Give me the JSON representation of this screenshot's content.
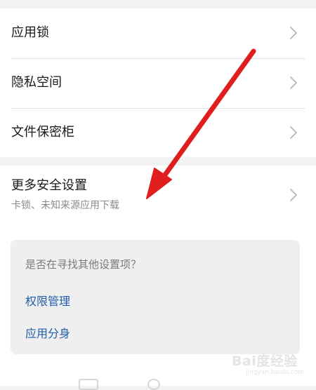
{
  "settings_group_1": {
    "items": [
      {
        "label": "应用锁"
      },
      {
        "label": "隐私空间"
      },
      {
        "label": "文件保密柜"
      }
    ]
  },
  "more_security": {
    "label": "更多安全设置",
    "sublabel": "卡锁、未知来源应用下载"
  },
  "suggestions": {
    "title": "是否在寻找其他设置项？",
    "links": [
      {
        "label": "权限管理"
      },
      {
        "label": "应用分身"
      }
    ]
  },
  "watermark": {
    "text": "Bai度经验",
    "subtext": "jingyan.baidu.com"
  },
  "colors": {
    "background": "#f2f2f2",
    "link": "#1f5ea8",
    "annotation_arrow": "#e01e1e",
    "chevron": "#b8b8b8"
  },
  "icons": {
    "chevron": "chevron-right-icon",
    "annotation": "red-arrow-annotation"
  }
}
